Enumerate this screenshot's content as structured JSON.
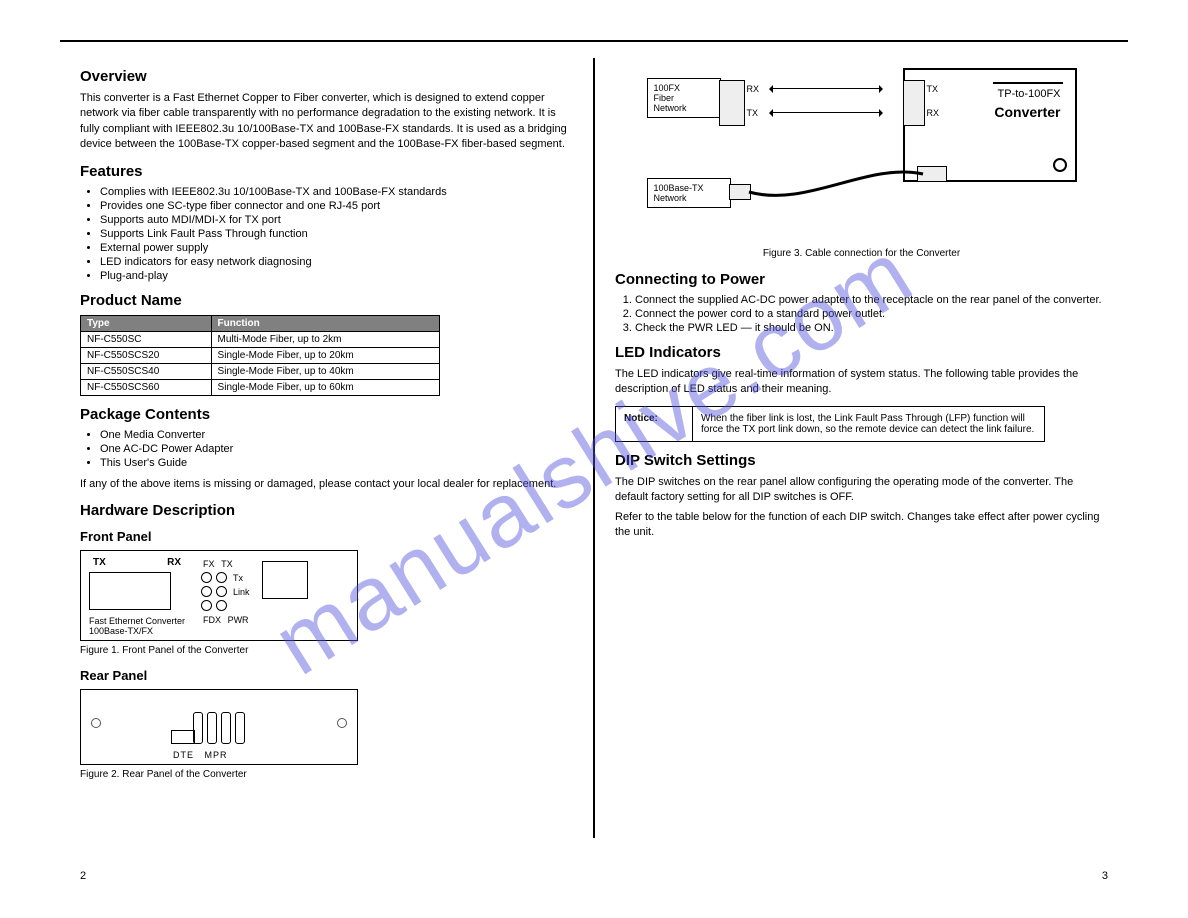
{
  "watermark": "manualshive.com",
  "left": {
    "h_overview": "Overview",
    "p_overview": "This converter is a Fast Ethernet Copper to Fiber converter, which is designed to extend copper network via fiber cable transparently with no performance degradation to the existing network. It is fully compliant with IEEE802.3u 10/100Base-TX and 100Base-FX standards. It is used as a bridging device between the 100Base-TX copper-based segment and the 100Base-FX fiber-based segment.",
    "h_features": "Features",
    "features": [
      "Complies with IEEE802.3u 10/100Base-TX and 100Base-FX standards",
      "Provides one SC-type fiber connector and one RJ-45 port",
      "Supports auto MDI/MDI-X for TX port",
      "Supports Link Fault Pass Through function",
      "External power supply",
      "LED indicators for easy network diagnosing",
      "Plug-and-play"
    ],
    "h_products": "Product Name",
    "table_headers": [
      "Type",
      "Function"
    ],
    "table_rows": [
      [
        "NF-C550SC",
        "Multi-Mode Fiber, up to 2km"
      ],
      [
        "NF-C550SCS20",
        "Single-Mode Fiber, up to 20km"
      ],
      [
        "NF-C550SCS40",
        "Single-Mode Fiber, up to 40km"
      ],
      [
        "NF-C550SCS60",
        "Single-Mode Fiber, up to 60km"
      ]
    ],
    "h_package": "Package Contents",
    "package": [
      "One Media Converter",
      "One AC-DC Power Adapter",
      "This User's Guide"
    ],
    "p_package_note": "If any of the above items is missing or damaged, please contact your local dealer for replacement.",
    "h_hardware": "Hardware Description",
    "h_front": "Front Panel",
    "fp_tx": "TX",
    "fp_rx": "RX",
    "fp_fx": "FX",
    "fp_tx2": "TX",
    "fp_txled": "Tx",
    "fp_link": "Link",
    "fp_fdx": "FDX",
    "fp_pwr": "PWR",
    "fp_caption1": "Fast Ethernet Converter",
    "fp_caption2": "100Base-TX/FX",
    "fig1": "Figure 1. Front Panel of the Converter",
    "h_rear": "Rear Panel",
    "rear_dte": "DTE",
    "rear_mpr": "MPR",
    "fig2": "Figure 2. Rear Panel of the Converter",
    "page_num": "2"
  },
  "right": {
    "diag_100fx": "100FX\nFiber\nNetwork",
    "diag_100tx": "100Base-TX\nNetwork",
    "diag_rx": "RX",
    "diag_tx": "TX",
    "conv_line1": "TP-to-100FX",
    "conv_line2": "Converter",
    "fig3": "Figure 3. Cable connection for the Converter",
    "h_connecting": "Connecting to Power",
    "power_steps": [
      "Connect the supplied AC-DC power adapter to the receptacle on the rear panel of the converter.",
      "Connect the power cord to a standard power outlet.",
      "Check the PWR LED — it should be ON."
    ],
    "h_led": "LED Indicators",
    "p_led": "The LED indicators give real-time information of system status. The following table provides the description of LED status and their meaning.",
    "notice_label": "Notice:",
    "notice_text": "When the fiber link is lost, the Link Fault Pass Through (LFP) function will force the TX port link down, so the remote device can detect the link failure.",
    "h_dip": "DIP Switch Settings",
    "p_dip1": "The DIP switches on the rear panel allow configuring the operating mode of the converter. The default factory setting for all DIP switches is OFF.",
    "p_dip2": "Refer to the table below for the function of each DIP switch. Changes take effect after power cycling the unit.",
    "page_num": "3"
  }
}
